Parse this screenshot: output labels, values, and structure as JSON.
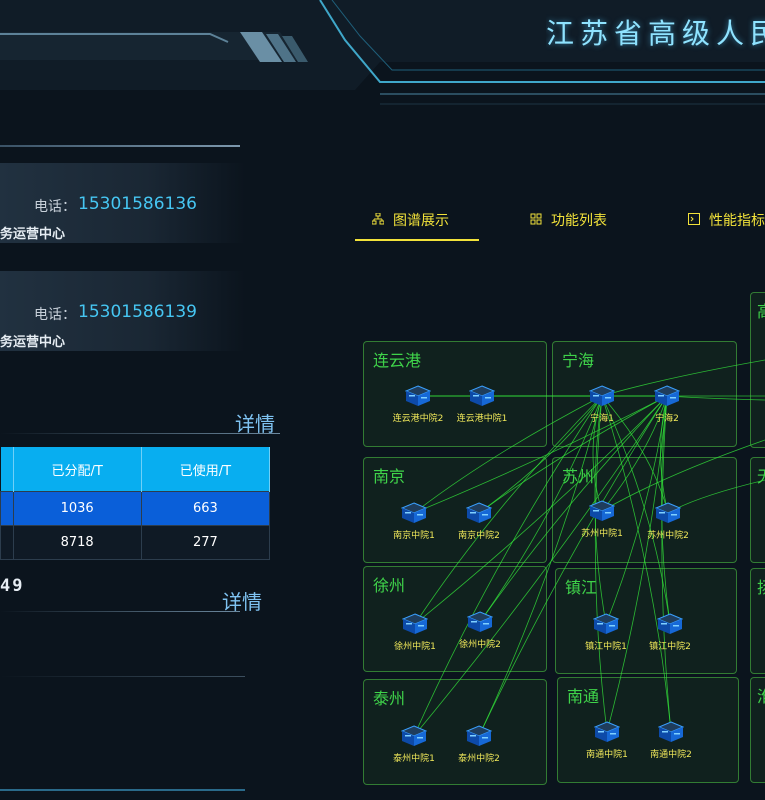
{
  "header": {
    "title": "江苏省高级人民"
  },
  "contacts": [
    {
      "phone_label": "电话：",
      "phone": "15301586136",
      "org": "务运营中心"
    },
    {
      "phone_label": "电话：",
      "phone": "15301586139",
      "org": "务运营中心"
    }
  ],
  "storage": {
    "detail_label": "详情",
    "headers": [
      "",
      "已分配/T",
      "已使用/T"
    ],
    "rows": [
      {
        "c0": "",
        "allocated": "1036",
        "used": "663"
      },
      {
        "c0": "",
        "allocated": "8718",
        "used": "277"
      }
    ]
  },
  "counter": {
    "value": "49",
    "detail_label": "详情"
  },
  "tabs": [
    {
      "label": "图谱展示",
      "icon": "graph-icon"
    },
    {
      "label": "功能列表",
      "icon": "grid-icon"
    },
    {
      "label": "性能指标",
      "icon": "terminal-icon"
    }
  ],
  "cities": [
    {
      "name": "连云港",
      "nodes": [
        "连云港中院2",
        "连云港中院1"
      ]
    },
    {
      "name": "宁海",
      "nodes": [
        "宁海1",
        "宁海2"
      ]
    },
    {
      "name": "南京",
      "nodes": [
        "南京中院1",
        "南京中院2"
      ]
    },
    {
      "name": "苏州",
      "nodes": [
        "苏州中院1",
        "苏州中院2"
      ]
    },
    {
      "name": "徐州",
      "nodes": [
        "徐州中院1",
        "徐州中院2"
      ]
    },
    {
      "name": "镇江",
      "nodes": [
        "镇江中院1",
        "镇江中院2"
      ]
    },
    {
      "name": "泰州",
      "nodes": [
        "泰州中院1",
        "泰州中院2"
      ]
    },
    {
      "name": "南通",
      "nodes": [
        "南通中院1",
        "南通中院2"
      ]
    }
  ],
  "edge_cities": [
    {
      "name": "高"
    },
    {
      "name": "无"
    },
    {
      "name": "扬"
    },
    {
      "name": "淮"
    }
  ],
  "colors": {
    "accent": "#f2e23a",
    "link": "#32e03a",
    "city_border": "#50c846",
    "table_head": "#08aef0"
  }
}
